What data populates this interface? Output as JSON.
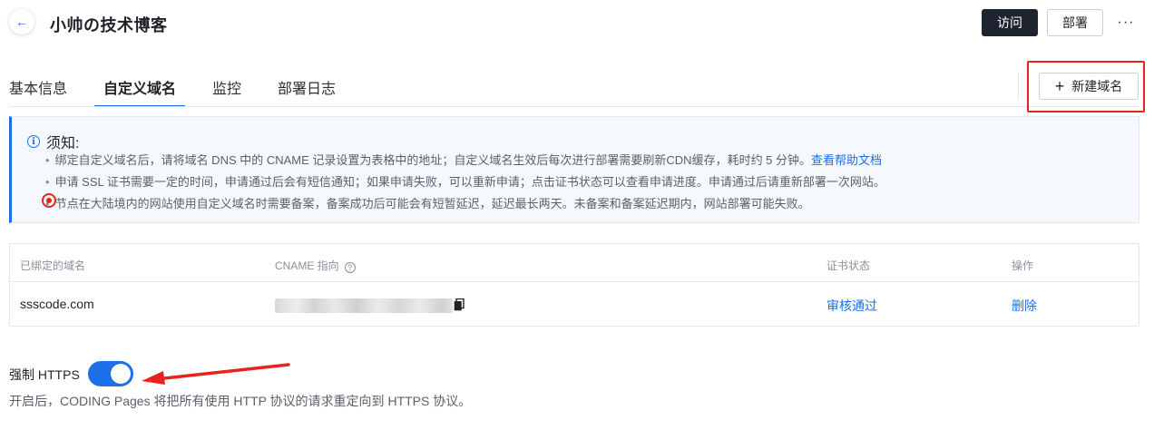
{
  "header": {
    "back_icon": "←",
    "title": "小帅の技术博客",
    "visit_label": "访问",
    "deploy_label": "部署",
    "more_label": "···"
  },
  "tabs": [
    {
      "label": "基本信息",
      "active": false
    },
    {
      "label": "自定义域名",
      "active": true
    },
    {
      "label": "监控",
      "active": false
    },
    {
      "label": "部署日志",
      "active": false
    }
  ],
  "new_domain": {
    "icon": "+",
    "label": "新建域名"
  },
  "notice": {
    "icon": "i",
    "title": "须知:",
    "lines": [
      "绑定自定义域名后，请将域名 DNS 中的 CNAME 记录设置为表格中的地址；自定义域名生效后每次进行部署需要刷新CDN缓存，耗时约 5 分钟。",
      "申请 SSL 证书需要一定的时间，申请通过后会有短信通知；如果申请失败，可以重新申请；点击证书状态可以查看申请进度。申请通过后请重新部署一次网站。",
      "节点在大陆境内的网站使用自定义域名时需要备案，备案成功后可能会有短暂延迟，延迟最长两天。未备案和备案延迟期内，网站部署可能失败。"
    ],
    "bullet": "•",
    "help_link": "查看帮助文档"
  },
  "table": {
    "headers": {
      "domain": "已绑定的域名",
      "cname": "CNAME 指向",
      "cname_help": "?",
      "cert": "证书状态",
      "action": "操作"
    },
    "rows": [
      {
        "domain": "ssscode.com",
        "cert_status": "审核通过",
        "action": "删除"
      }
    ]
  },
  "https": {
    "label": "强制 HTTPS",
    "enabled": true,
    "description": "开启后，CODING Pages 将把所有使用 HTTP 协议的请求重定向到 HTTPS 协议。"
  },
  "colors": {
    "accent": "#1c6fe8",
    "dark_button": "#1e2330",
    "annotation": "#e8231c"
  }
}
